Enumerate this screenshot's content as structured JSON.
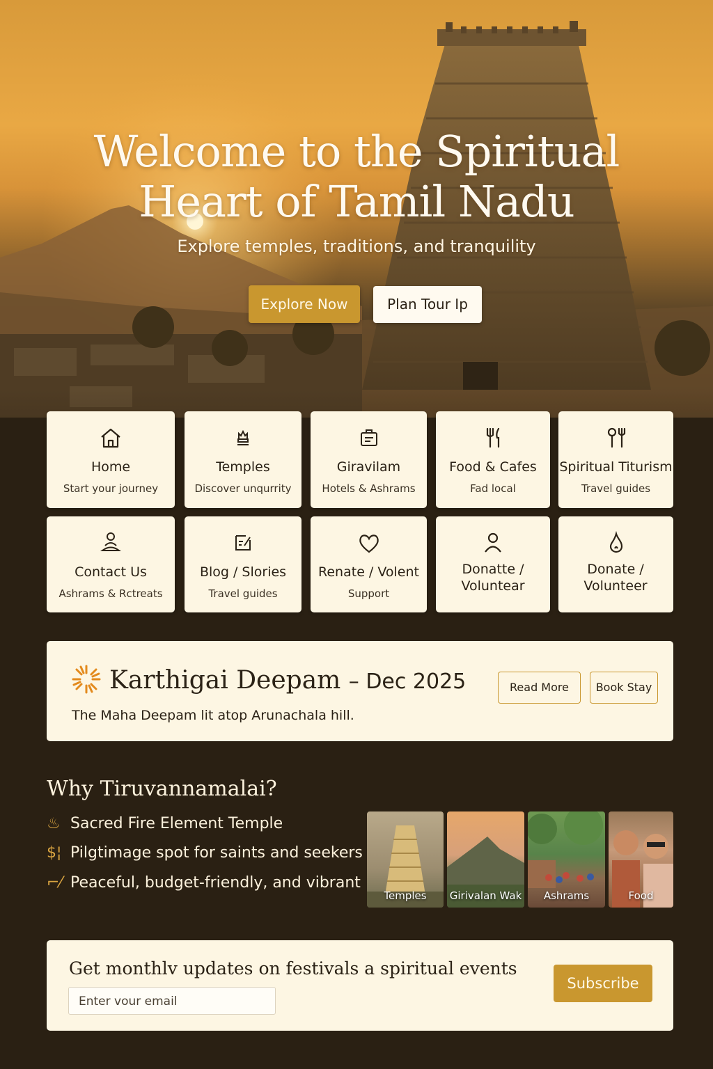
{
  "hero": {
    "title_line1": "Welcome to the Spiritual",
    "title_line2": "Heart of Tamil Nadu",
    "subtitle": "Explore temples, traditions, and tranquility",
    "primary_button": "Explore Now",
    "secondary_button": "Plan Tour Ip"
  },
  "nav_cards": [
    {
      "icon": "home-icon",
      "title": "Home",
      "subtitle": "Start your journey"
    },
    {
      "icon": "temple-icon",
      "title": "Temples",
      "subtitle": "Discover unqurrity"
    },
    {
      "icon": "hotel-icon",
      "title": "Giravilam",
      "subtitle": "Hotels & Ashrams"
    },
    {
      "icon": "fork-knife-icon",
      "title": "Food & Cafes",
      "subtitle": "Fad local"
    },
    {
      "icon": "utensils-icon",
      "title": "Spiritual Titurism",
      "subtitle": "Travel guides"
    },
    {
      "icon": "meditation-icon",
      "title": "Contact Us",
      "subtitle": "Ashrams & Rctreats"
    },
    {
      "icon": "blog-icon",
      "title": "Blog / Slories",
      "subtitle": "Travel guides"
    },
    {
      "icon": "heart-icon",
      "title": "Renate / Volent",
      "subtitle": "Support"
    },
    {
      "icon": "person-icon",
      "title": "Donatte / Voluntear",
      "subtitle": ""
    },
    {
      "icon": "flame-icon",
      "title": "Donate / Volunteer",
      "subtitle": ""
    }
  ],
  "event": {
    "icon": "sun-icon",
    "title": "Karthigai Deepam",
    "date": "– Dec 2025",
    "description": "The Maha Deepam lit atop Arunachala hill.",
    "read_more": "Read More",
    "book_stay": "Book Stay"
  },
  "why": {
    "title": "Why Tiruvannamalai?",
    "items": [
      {
        "icon": "fire-icon",
        "glyph": "♨",
        "text": "Sacred Fire Element Temple"
      },
      {
        "icon": "dollar-icon",
        "glyph": "$¦",
        "text": "Pilgtimage spot for saints and seekers"
      },
      {
        "icon": "walker-icon",
        "glyph": "⌐⁄",
        "text": "Peaceful, budget-friendly, and vibrant"
      }
    ],
    "gallery": [
      {
        "label": "Temples"
      },
      {
        "label": "Girivalan Wak"
      },
      {
        "label": "Ashrams"
      },
      {
        "label": "Food"
      }
    ]
  },
  "newsletter": {
    "heading": "Get monthlv updates on festivals a spiritual events",
    "placeholder": "Enter vour email",
    "button": "Subscribe"
  },
  "colors": {
    "accent": "#c9972f",
    "card_bg": "#fdf6e3",
    "page_bg": "#2a2013"
  }
}
